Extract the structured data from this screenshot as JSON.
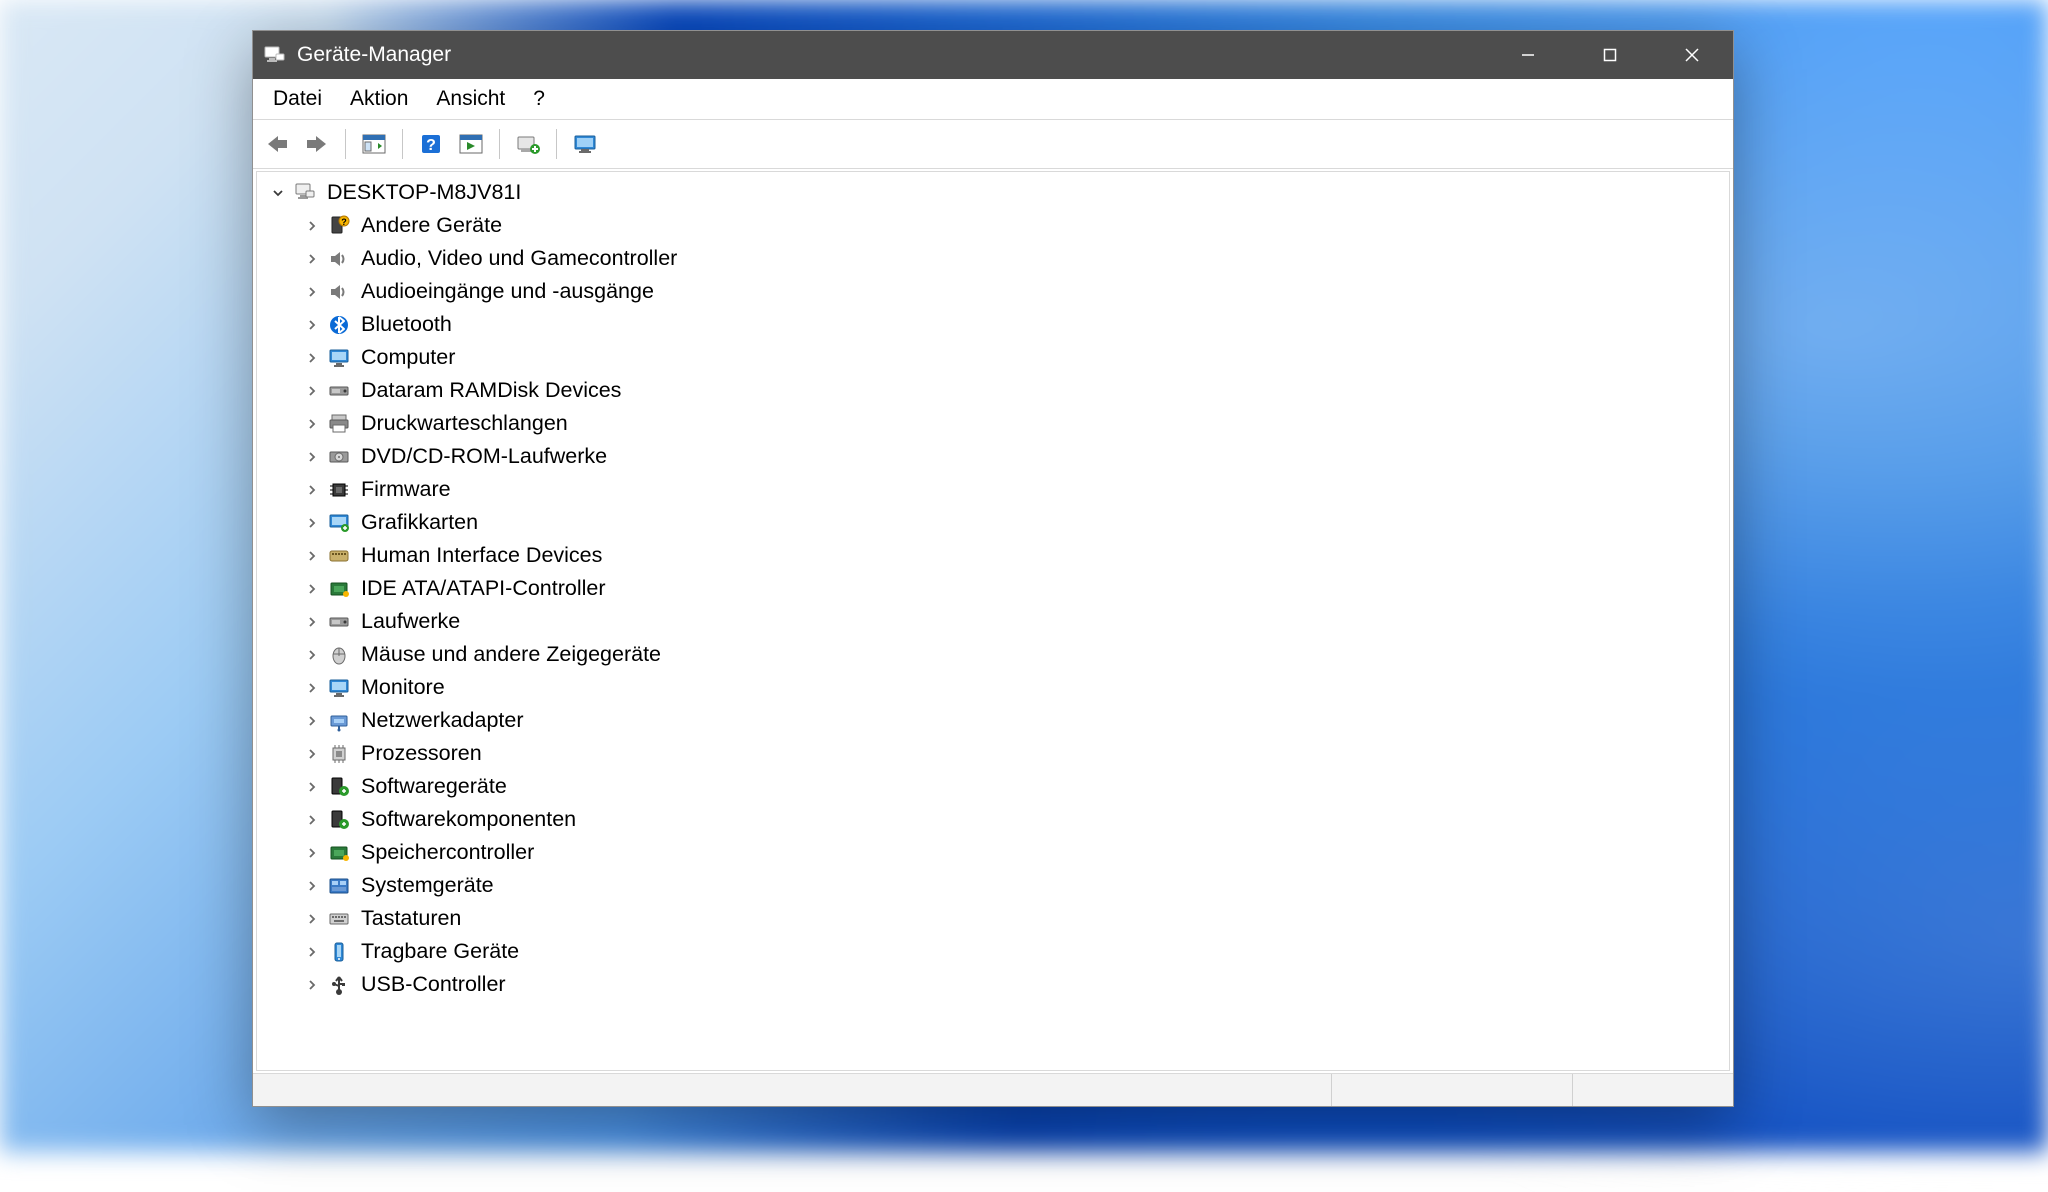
{
  "window": {
    "title": "Geräte-Manager"
  },
  "menu": {
    "items": [
      "Datei",
      "Aktion",
      "Ansicht",
      "?"
    ]
  },
  "toolbar": {
    "buttons": [
      "back",
      "forward",
      "|",
      "show-hide-tree",
      "|",
      "help",
      "update-driver",
      "|",
      "uninstall-device",
      "|",
      "scan-hardware"
    ]
  },
  "tree": {
    "root": {
      "label": "DESKTOP-M8JV81I",
      "expanded": true,
      "icon": "computer-node"
    },
    "categories": [
      {
        "label": "Andere Geräte",
        "icon": "unknown-device"
      },
      {
        "label": "Audio, Video und Gamecontroller",
        "icon": "audio"
      },
      {
        "label": "Audioeingänge und -ausgänge",
        "icon": "audio"
      },
      {
        "label": "Bluetooth",
        "icon": "bluetooth"
      },
      {
        "label": "Computer",
        "icon": "monitor"
      },
      {
        "label": "Dataram RAMDisk Devices",
        "icon": "disk"
      },
      {
        "label": "Druckwarteschlangen",
        "icon": "printer"
      },
      {
        "label": "DVD/CD-ROM-Laufwerke",
        "icon": "optical"
      },
      {
        "label": "Firmware",
        "icon": "chip"
      },
      {
        "label": "Grafikkarten",
        "icon": "display-adapter"
      },
      {
        "label": "Human Interface Devices",
        "icon": "hid"
      },
      {
        "label": "IDE ATA/ATAPI-Controller",
        "icon": "storage-controller"
      },
      {
        "label": "Laufwerke",
        "icon": "disk"
      },
      {
        "label": "Mäuse und andere Zeigegeräte",
        "icon": "mouse"
      },
      {
        "label": "Monitore",
        "icon": "monitor"
      },
      {
        "label": "Netzwerkadapter",
        "icon": "network"
      },
      {
        "label": "Prozessoren",
        "icon": "cpu"
      },
      {
        "label": "Softwaregeräte",
        "icon": "software"
      },
      {
        "label": "Softwarekomponenten",
        "icon": "software"
      },
      {
        "label": "Speichercontroller",
        "icon": "storage-controller"
      },
      {
        "label": "Systemgeräte",
        "icon": "system"
      },
      {
        "label": "Tastaturen",
        "icon": "keyboard"
      },
      {
        "label": "Tragbare Geräte",
        "icon": "portable"
      },
      {
        "label": "USB-Controller",
        "icon": "usb"
      }
    ]
  }
}
